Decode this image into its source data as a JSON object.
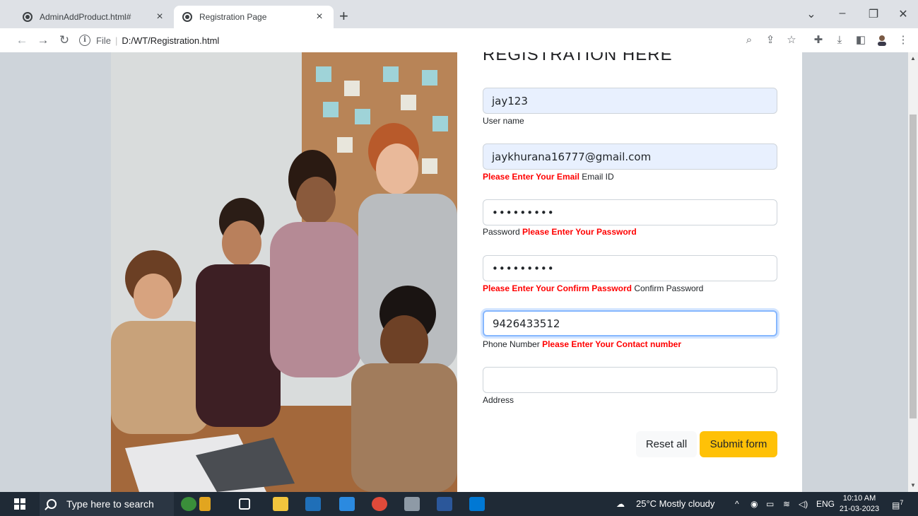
{
  "browser": {
    "tabs": [
      {
        "title": "AdminAddProduct.html#",
        "active": false
      },
      {
        "title": "Registration Page",
        "active": true
      }
    ],
    "new_tab_icon": "plus-icon",
    "address": {
      "scheme": "File",
      "path": "D:/WT/Registration.html"
    },
    "window_controls": [
      "chevron-down-icon",
      "minimize-icon",
      "restore-icon",
      "close-icon"
    ]
  },
  "form": {
    "heading": "REGISTRATION HERE",
    "username": {
      "value": "jay123",
      "label": "User name"
    },
    "email": {
      "value": "jaykhurana16777@gmail.com",
      "error": "Please Enter Your Email",
      "label": "Email ID"
    },
    "password": {
      "value": "•••••••••",
      "label": "Password",
      "error": "Please Enter Your Password"
    },
    "confirm_password": {
      "value": "•••••••••",
      "error": "Please Enter Your Confirm Password",
      "label": "Confirm Password"
    },
    "phone": {
      "value": "9426433512",
      "label": "Phone Number",
      "error": "Please Enter Your Contact number"
    },
    "address": {
      "value": "",
      "label": "Address"
    },
    "reset_label": "Reset all",
    "submit_label": "Submit form"
  },
  "taskbar": {
    "search_placeholder": "Type here to search",
    "weather": "25°C  Mostly cloudy",
    "language": "ENG",
    "time": "10:10 AM",
    "date": "21-03-2023",
    "notification_count": "7"
  },
  "colors": {
    "error": "#ff0000",
    "submit": "#ffc107",
    "autofill": "#e8f0fe",
    "page_bg": "#ced4da",
    "taskbar_bg": "#1f2a36"
  }
}
